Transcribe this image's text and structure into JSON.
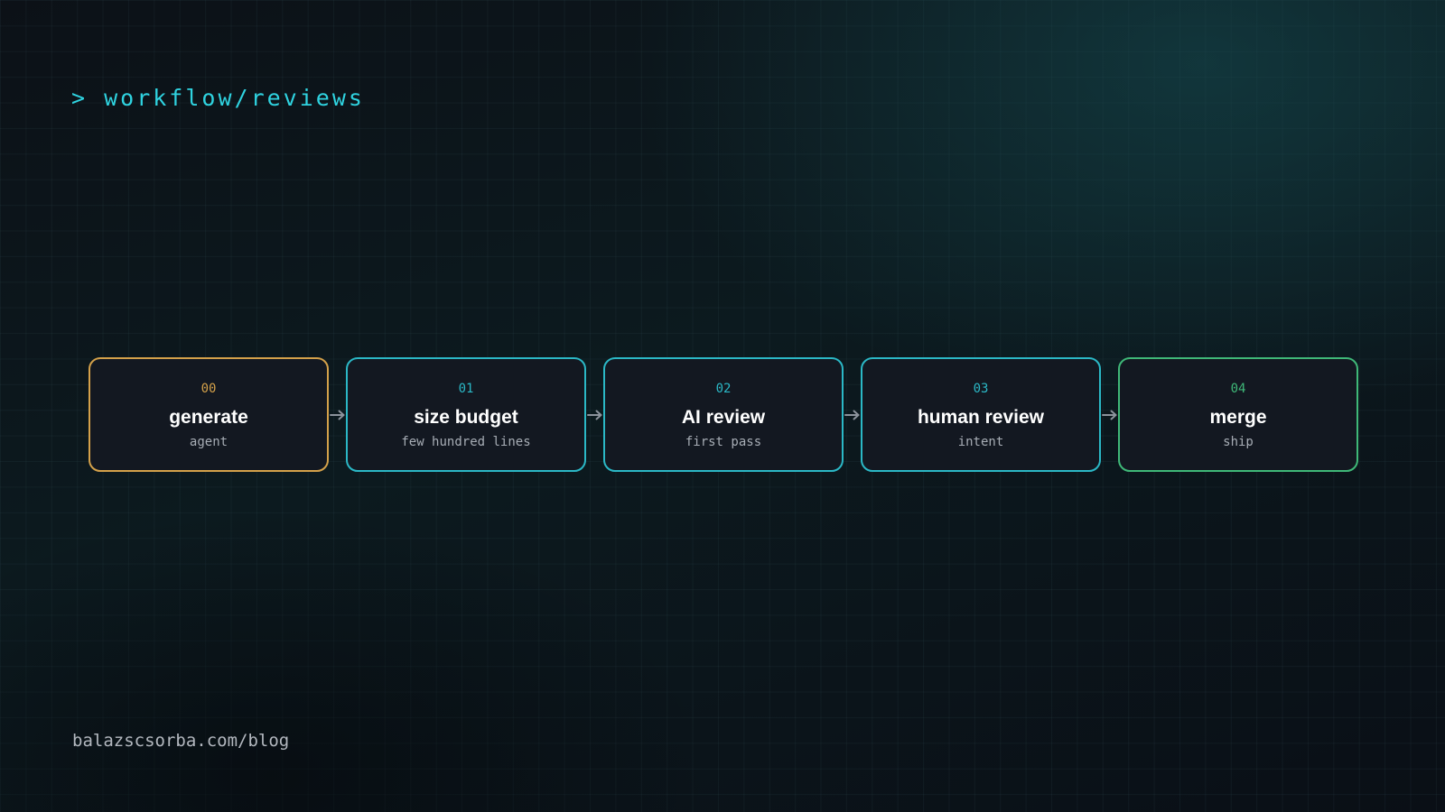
{
  "header": {
    "path": "> workflow/reviews"
  },
  "pipeline": {
    "steps": [
      {
        "number": "00",
        "title": "generate",
        "subtitle": "agent",
        "color": "#d4a14a"
      },
      {
        "number": "01",
        "title": "size budget",
        "subtitle": "few hundred lines",
        "color": "#2bb8c6"
      },
      {
        "number": "02",
        "title": "AI review",
        "subtitle": "first pass",
        "color": "#2bb8c6"
      },
      {
        "number": "03",
        "title": "human review",
        "subtitle": "intent",
        "color": "#2bb8c6"
      },
      {
        "number": "04",
        "title": "merge",
        "subtitle": "ship",
        "color": "#3fb878"
      }
    ],
    "arrow_color": "#8c939c"
  },
  "footer": {
    "url": "balazscsorba.com/blog"
  }
}
